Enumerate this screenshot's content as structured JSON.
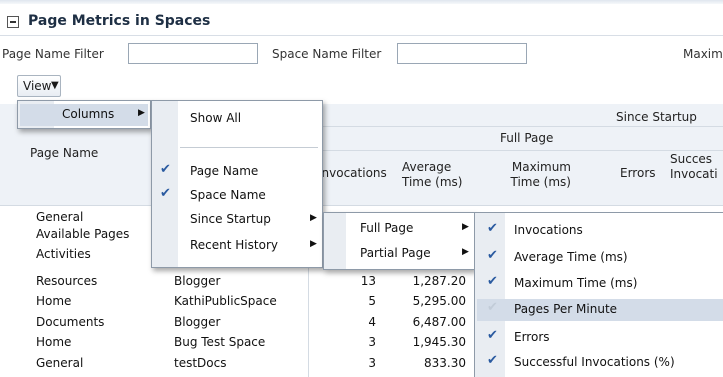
{
  "header": {
    "title": "Page Metrics in Spaces"
  },
  "filters": {
    "page_name_label": "Page Name Filter",
    "space_name_label": "Space Name Filter",
    "maximum_label": "Maxim"
  },
  "toolbar": {
    "view_label": "View"
  },
  "table": {
    "page_name_header": "Page Name",
    "since_startup_header": "Since Startup",
    "full_page_header": "Full Page",
    "invocations_header": "Invocations",
    "avg_time_header": "Average Time (ms)",
    "max_time_header": "Maximum Time (ms)",
    "errors_header": "Errors",
    "success_header": "Succes Invocati",
    "row0": {
      "page": "General",
      "space": "",
      "inv": "",
      "avg": "",
      "max": ""
    },
    "row1": {
      "page": "Available Pages",
      "space": "",
      "inv": "",
      "avg": ""
    },
    "row2": {
      "page": "Activities",
      "space": "",
      "inv": "",
      "avg": ""
    },
    "row3": {
      "page": "Resources",
      "space": "Blogger",
      "inv": "13",
      "avg": "1,287.20"
    },
    "row4": {
      "page": "Home",
      "space": "KathiPublicSpace",
      "inv": "5",
      "avg": "5,295.00"
    },
    "row5": {
      "page": "Documents",
      "space": "Blogger",
      "inv": "4",
      "avg": "6,487.00"
    },
    "row6": {
      "page": "Home",
      "space": "Bug Test Space",
      "inv": "3",
      "avg": "1,945.30"
    },
    "row7": {
      "page": "General",
      "space": "testDocs",
      "inv": "3",
      "avg": "833.30"
    }
  },
  "view_menu": {
    "columns": "Columns"
  },
  "columns_menu": {
    "show_all": "Show All",
    "page_name": "Page Name",
    "space_name": "Space Name",
    "since_startup": "Since Startup",
    "recent_history": "Recent History"
  },
  "since_startup_menu": {
    "full_page": "Full Page",
    "partial_page": "Partial Page"
  },
  "full_page_menu": {
    "invocations": "Invocations",
    "average_time": "Average Time (ms)",
    "maximum_time": "Maximum Time (ms)",
    "pages_per_minute": "Pages Per Minute",
    "errors": "Errors",
    "successful_invocations": "Successful Invocations (%)"
  },
  "colors": {
    "title": "#1e2f44",
    "highlight": "#d3dce8",
    "check": "#2a5aa0"
  }
}
